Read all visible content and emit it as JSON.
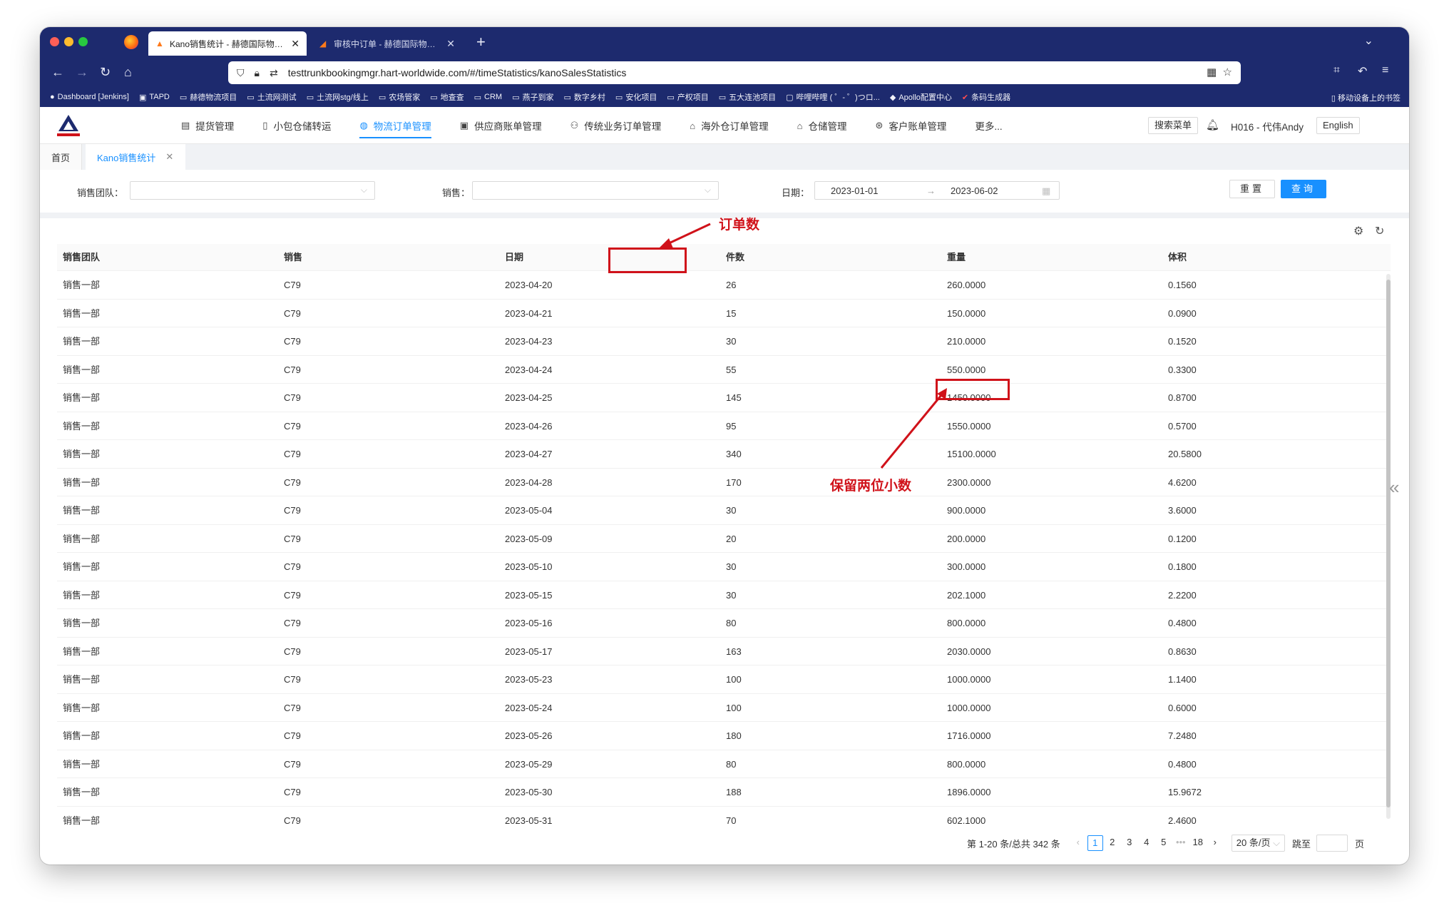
{
  "browser": {
    "tabs": [
      {
        "title": "Kano销售统计 - 赫德国际物流管理系统"
      },
      {
        "title": "审核中订单 - 赫德国际物流管理系统"
      }
    ],
    "url": "testtrunkbookingmgr.hart-worldwide.com/#/timeStatistics/kanoSalesStatistics",
    "bookmarks": [
      "Dashboard [Jenkins]",
      "TAPD",
      "赫德物流项目",
      "土流网测试",
      "土流网stg/线上",
      "农场管家",
      "地查查",
      "CRM",
      "燕子到家",
      "数字乡村",
      "安化项目",
      "产权项目",
      "五大连池项目",
      "哔哩哔哩 ( ゜- ゜)つロ...",
      "Apollo配置中心",
      "条码生成器"
    ],
    "bookmarks_right": "移动设备上的书签"
  },
  "header": {
    "menu": [
      {
        "label": "提货管理",
        "icon": "truck-icon"
      },
      {
        "label": "小包仓储转运",
        "icon": "document-icon"
      },
      {
        "label": "物流订单管理",
        "icon": "globe-icon"
      },
      {
        "label": "供应商账单管理",
        "icon": "invoice-icon"
      },
      {
        "label": "传统业务订单管理",
        "icon": "network-icon"
      },
      {
        "label": "海外仓订单管理",
        "icon": "home-icon"
      },
      {
        "label": "仓储管理",
        "icon": "warehouse-icon"
      },
      {
        "label": "客户账单管理",
        "icon": "yen-icon"
      },
      {
        "label": "更多...",
        "icon": ""
      }
    ],
    "search_menu": "搜索菜单",
    "user": "H016 - 代伟Andy",
    "language": "English"
  },
  "tags": {
    "home": "首页",
    "current": "Kano销售统计"
  },
  "filter": {
    "team_label": "销售团队：",
    "sales_label": "销售：",
    "date_label": "日期：",
    "date_start": "2023-01-01",
    "date_sep": "→",
    "date_end": "2023-06-02",
    "reset": "重置",
    "query": "查询"
  },
  "table": {
    "columns": [
      "销售团队",
      "销售",
      "日期",
      "件数",
      "重量",
      "体积"
    ],
    "rows": [
      [
        "销售一部",
        "C79",
        "2023-04-20",
        "26",
        "260.0000",
        "0.1560"
      ],
      [
        "销售一部",
        "C79",
        "2023-04-21",
        "15",
        "150.0000",
        "0.0900"
      ],
      [
        "销售一部",
        "C79",
        "2023-04-23",
        "30",
        "210.0000",
        "0.1520"
      ],
      [
        "销售一部",
        "C79",
        "2023-04-24",
        "55",
        "550.0000",
        "0.3300"
      ],
      [
        "销售一部",
        "C79",
        "2023-04-25",
        "145",
        "1450.0000",
        "0.8700"
      ],
      [
        "销售一部",
        "C79",
        "2023-04-26",
        "95",
        "1550.0000",
        "0.5700"
      ],
      [
        "销售一部",
        "C79",
        "2023-04-27",
        "340",
        "15100.0000",
        "20.5800"
      ],
      [
        "销售一部",
        "C79",
        "2023-04-28",
        "170",
        "2300.0000",
        "4.6200"
      ],
      [
        "销售一部",
        "C79",
        "2023-05-04",
        "30",
        "900.0000",
        "3.6000"
      ],
      [
        "销售一部",
        "C79",
        "2023-05-09",
        "20",
        "200.0000",
        "0.1200"
      ],
      [
        "销售一部",
        "C79",
        "2023-05-10",
        "30",
        "300.0000",
        "0.1800"
      ],
      [
        "销售一部",
        "C79",
        "2023-05-15",
        "30",
        "202.1000",
        "2.2200"
      ],
      [
        "销售一部",
        "C79",
        "2023-05-16",
        "80",
        "800.0000",
        "0.4800"
      ],
      [
        "销售一部",
        "C79",
        "2023-05-17",
        "163",
        "2030.0000",
        "0.8630"
      ],
      [
        "销售一部",
        "C79",
        "2023-05-23",
        "100",
        "1000.0000",
        "1.1400"
      ],
      [
        "销售一部",
        "C79",
        "2023-05-24",
        "100",
        "1000.0000",
        "0.6000"
      ],
      [
        "销售一部",
        "C79",
        "2023-05-26",
        "180",
        "1716.0000",
        "7.2480"
      ],
      [
        "销售一部",
        "C79",
        "2023-05-29",
        "80",
        "800.0000",
        "0.4800"
      ],
      [
        "销售一部",
        "C79",
        "2023-05-30",
        "188",
        "1896.0000",
        "15.9672"
      ],
      [
        "销售一部",
        "C79",
        "2023-05-31",
        "70",
        "602.1000",
        "2.4600"
      ]
    ]
  },
  "annotations": {
    "order_count": "订单数",
    "two_decimals": "保留两位小数"
  },
  "pagination": {
    "summary": "第 1-20 条/总共 342 条",
    "pages": [
      "1",
      "2",
      "3",
      "4",
      "5",
      "•••",
      "18"
    ],
    "page_size": "20 条/页",
    "jump_label": "跳至",
    "page_unit": "页"
  },
  "colors": {
    "accent": "#1890ff",
    "browser_chrome": "#1d2a6e",
    "annotation": "#d0121a"
  }
}
